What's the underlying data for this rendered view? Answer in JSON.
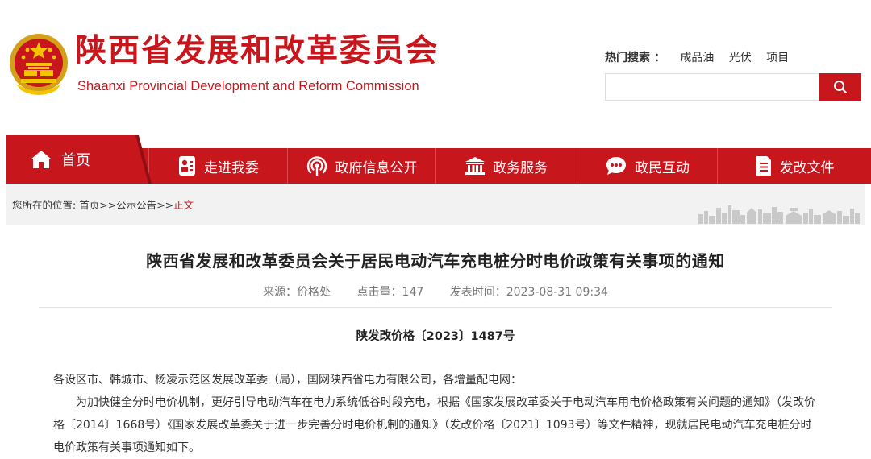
{
  "header": {
    "title": "陕西省发展和改革委员会",
    "subtitle": "Shaanxi Provincial Development and Reform Commission",
    "hot_search": {
      "label": "热门搜索 ：",
      "items": [
        "成品油",
        "光伏",
        "项目"
      ]
    },
    "search": {
      "placeholder": ""
    }
  },
  "nav": {
    "home": "首页",
    "items": [
      {
        "label": "走进我委",
        "icon": "person-card-icon"
      },
      {
        "label": "政府信息公开",
        "icon": "broadcast-icon"
      },
      {
        "label": "政务服务",
        "icon": "government-building-icon"
      },
      {
        "label": "政民互动",
        "icon": "chat-bubble-icon"
      },
      {
        "label": "发改文件",
        "icon": "document-icon"
      }
    ]
  },
  "breadcrumb": {
    "prefix": "您所在的位置:",
    "items": [
      "首页",
      "公示公告"
    ],
    "separator": ">>",
    "current": "正文"
  },
  "article": {
    "title": "陕西省发展和改革委员会关于居民电动汽车充电桩分时电价政策有关事项的通知",
    "meta": {
      "source": "来源：价格处",
      "hits": "点击量：147",
      "date": "发表时间：2023-08-31 09:34"
    },
    "doc_number": "陕发改价格〔2023〕1487号",
    "paragraphs": [
      "各设区市、韩城市、杨凌示范区发展改革委（局），国网陕西省电力有限公司，各增量配电网：",
      "为加快健全分时电价机制，更好引导电动汽车在电力系统低谷时段充电，根据《国家发展改革委关于电动汽车用电价格政策有关问题的通知》（发改价格〔2014〕1668号）《国家发展改革委关于进一步完善分时电价机制的通知》（发改价格〔2021〕1093号）等文件精神，现就居民电动汽车充电桩分时电价政策有关事项通知如下。"
    ]
  },
  "colors": {
    "brand_red": "#c8161d",
    "dark_red": "#8e0f14",
    "gray_bg": "#f2f2f2"
  }
}
